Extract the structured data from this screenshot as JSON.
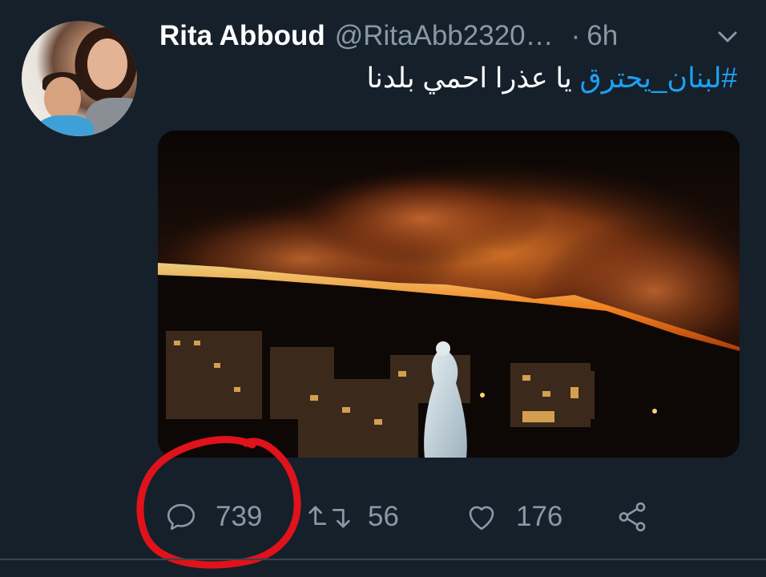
{
  "tweet": {
    "author_name": "Rita Abboud",
    "handle": "@RitaAbb2320…",
    "separator": "·",
    "time": "6h",
    "hashtag": "#لبنان_يحترق",
    "text_rest": "يا عذرا احمي بلدنا"
  },
  "icons": {
    "menu": "chevron-down-icon",
    "reply": "reply-icon",
    "retweet": "retweet-icon",
    "like": "heart-icon",
    "share": "share-icon"
  },
  "actions": {
    "reply_count": "739",
    "retweet_count": "56",
    "like_count": "176"
  },
  "colors": {
    "background": "#15202b",
    "hashtag": "#1da1f2",
    "secondary_text": "#8899a6",
    "annotation": "#e0121b"
  }
}
